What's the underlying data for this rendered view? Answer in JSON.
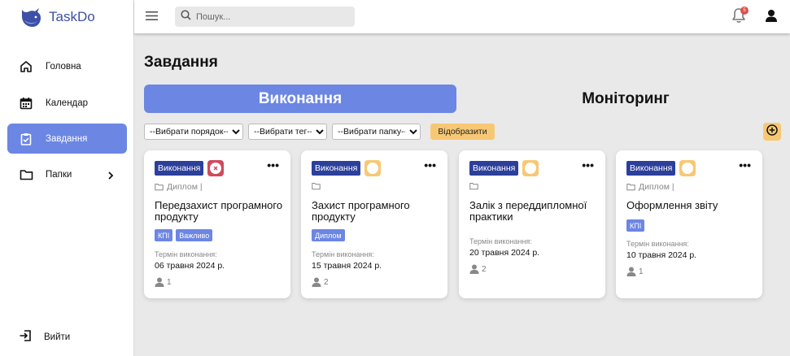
{
  "app": {
    "name": "TaskDo"
  },
  "sidebar": {
    "items": [
      {
        "label": "Головна",
        "icon": "home-icon"
      },
      {
        "label": "Календар",
        "icon": "calendar-icon"
      },
      {
        "label": "Завдання",
        "icon": "task-clipboard-icon",
        "active": true
      },
      {
        "label": "Папки",
        "icon": "folder-icon",
        "has_submenu": true
      }
    ],
    "logout_label": "Вийти"
  },
  "header": {
    "search_placeholder": "Пошук...",
    "notification_count": "5"
  },
  "main": {
    "title": "Завдання",
    "tabs": [
      {
        "label": "Виконання",
        "active": true
      },
      {
        "label": "Моніторинг",
        "active": false
      }
    ],
    "filters": {
      "order": {
        "selected": "--Вибрати порядок--"
      },
      "tag": {
        "selected": "--Вибрати тег--"
      },
      "folder": {
        "selected": "--Вибрати папку--"
      }
    },
    "show_button_label": "Відобразити"
  },
  "cards": [
    {
      "status": "Виконання",
      "state": "red",
      "folder": "Диплом |",
      "title": "Передзахист програмного продукту",
      "tags": [
        "КПІ",
        "Важливо"
      ],
      "due_label": "Термін виконання:",
      "due_date": "06 травня 2024 р.",
      "assignees": "1"
    },
    {
      "status": "Виконання",
      "state": "yellow",
      "folder": "",
      "title": "Захист програмного продукту",
      "tags": [
        "Диплом"
      ],
      "due_label": "Термін виконання:",
      "due_date": "15 травня 2024 р.",
      "assignees": "2"
    },
    {
      "status": "Виконання",
      "state": "yellow",
      "folder": "",
      "title": "Залік з переддипломної практики",
      "tags": [],
      "due_label": "Термін виконання:",
      "due_date": "20 травня 2024 р.",
      "assignees": "2"
    },
    {
      "status": "Виконання",
      "state": "yellow",
      "folder": "Диплом |",
      "title": "Оформлення звіту",
      "tags": [
        "КПІ"
      ],
      "due_label": "Термін виконання:",
      "due_date": "10 травня 2024 р.",
      "assignees": "1"
    }
  ],
  "colors": {
    "accent": "#6c86e3",
    "status_tag": "#2c3f9b",
    "yellow": "#f7c873",
    "red": "#cf4a5e"
  }
}
